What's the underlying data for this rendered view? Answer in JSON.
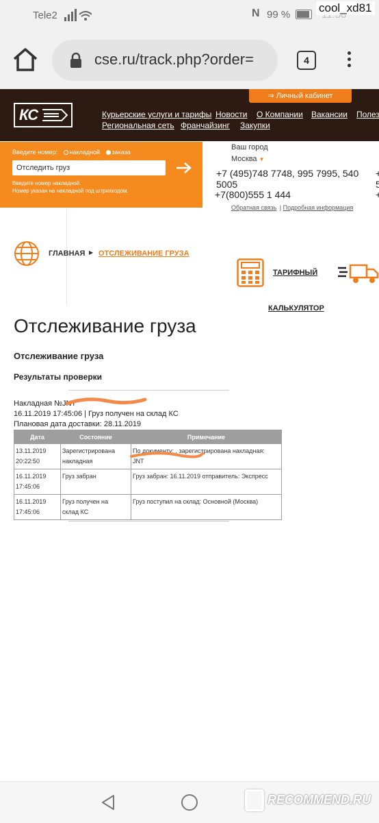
{
  "statusbar": {
    "carrier": "Tele2",
    "battery": "99 %",
    "time": "11:50",
    "username": "cool_xd81"
  },
  "browser": {
    "url": "cse.ru/track.php?order=",
    "tabs_count": "4"
  },
  "header": {
    "cabinet": "Личный кабинет",
    "logo_text": "КС",
    "nav_row1": [
      "Курьерские услуги и тарифы",
      "Новости",
      "О Компании",
      "Вакансии",
      "Полез"
    ],
    "nav_row2": [
      "Региональная сеть",
      "Франчайзинг",
      "Закупки"
    ]
  },
  "tracking": {
    "label": "Введите номер:",
    "radio_waybill": "накладной",
    "radio_order": "заказа",
    "placeholder": "Отследить груз",
    "hint1": "Введите номер накладной.",
    "hint2": "Номер указан на накладной под штрихкодом."
  },
  "contacts": {
    "city_label": "Ваш город",
    "city": "Москва",
    "phone1": "+7 (495)748 7748, 995 7995, 540",
    "phone1b": "5005",
    "phone2": "+7(800)555 1 444",
    "feedback": "Обратная связь",
    "details": "Подробная информация",
    "phone_right1": "+",
    "phone_right2": "5",
    "phone_right3": "+"
  },
  "breadcrumb": {
    "home": "ГЛАВНАЯ",
    "current": "ОТСЛЕЖИВАНИЕ ГРУЗА"
  },
  "calculator": {
    "label1": "ТАРИФНЫЙ",
    "label2": "КАЛЬКУЛЯТОР"
  },
  "content": {
    "title": "Отслеживание груза",
    "subtitle": "Отслеживание груза",
    "results_title": "Результаты проверки",
    "waybill": "Накладная №JNT",
    "status_line": "16.11.2019 17:45:06 | Груз получен на склад КС",
    "planned_date": "Плановая дата доставки: 28.11.2019"
  },
  "table": {
    "headers": [
      "Дата",
      "Состояние",
      "Примечание"
    ],
    "rows": [
      {
        "date1": "13.11.2019",
        "date2": "20:22:50",
        "state1": "Зарегистрирована",
        "state2": "накладная",
        "note1": "По документу: , зарегистрирована накладная:",
        "note2": "JNT"
      },
      {
        "date1": "16.11.2019",
        "date2": "17:45:06",
        "state1": "Груз забран",
        "state2": "",
        "note1": "Груз забран: 16.11.2019 отправитель: Экспресс",
        "note2": ""
      },
      {
        "date1": "16.11.2019",
        "date2": "17:45:06",
        "state1": "Груз получен на",
        "state2": "склад КС",
        "note1": "Груз поступил на склад: Основной (Москва)",
        "note2": ""
      }
    ]
  },
  "watermark": "RECOMMEND.RU",
  "colors": {
    "brand_orange": "#f58a1f",
    "header_dark": "#2d1a12",
    "table_header": "#9e9e9e"
  }
}
